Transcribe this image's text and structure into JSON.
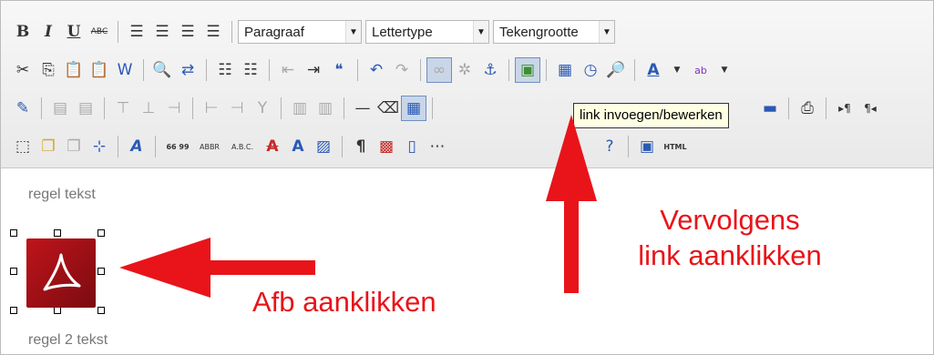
{
  "toolbar": {
    "format_select": "Paragraaf",
    "font_select": "Lettertype",
    "size_select": "Tekengrootte",
    "bold_label": "B",
    "italic_label": "I",
    "underline_label": "U",
    "strike_label": "ABC",
    "abbr_label": "ABBR",
    "acronym_label": "A.B.C.",
    "html_label": "HTML",
    "quote_label": "66 99"
  },
  "tooltip": {
    "text": "link invoegen/bewerken"
  },
  "content": {
    "line1": "regel tekst",
    "line2": "regel 2 tekst"
  },
  "annotations": {
    "image_click": "Afb aanklikken",
    "link_click_line1": "Vervolgens",
    "link_click_line2": "link aanklikken"
  },
  "colors": {
    "annotation_red": "#e8141a",
    "pdf_icon": "#b3121a",
    "active_button": "#c9d6e8"
  }
}
